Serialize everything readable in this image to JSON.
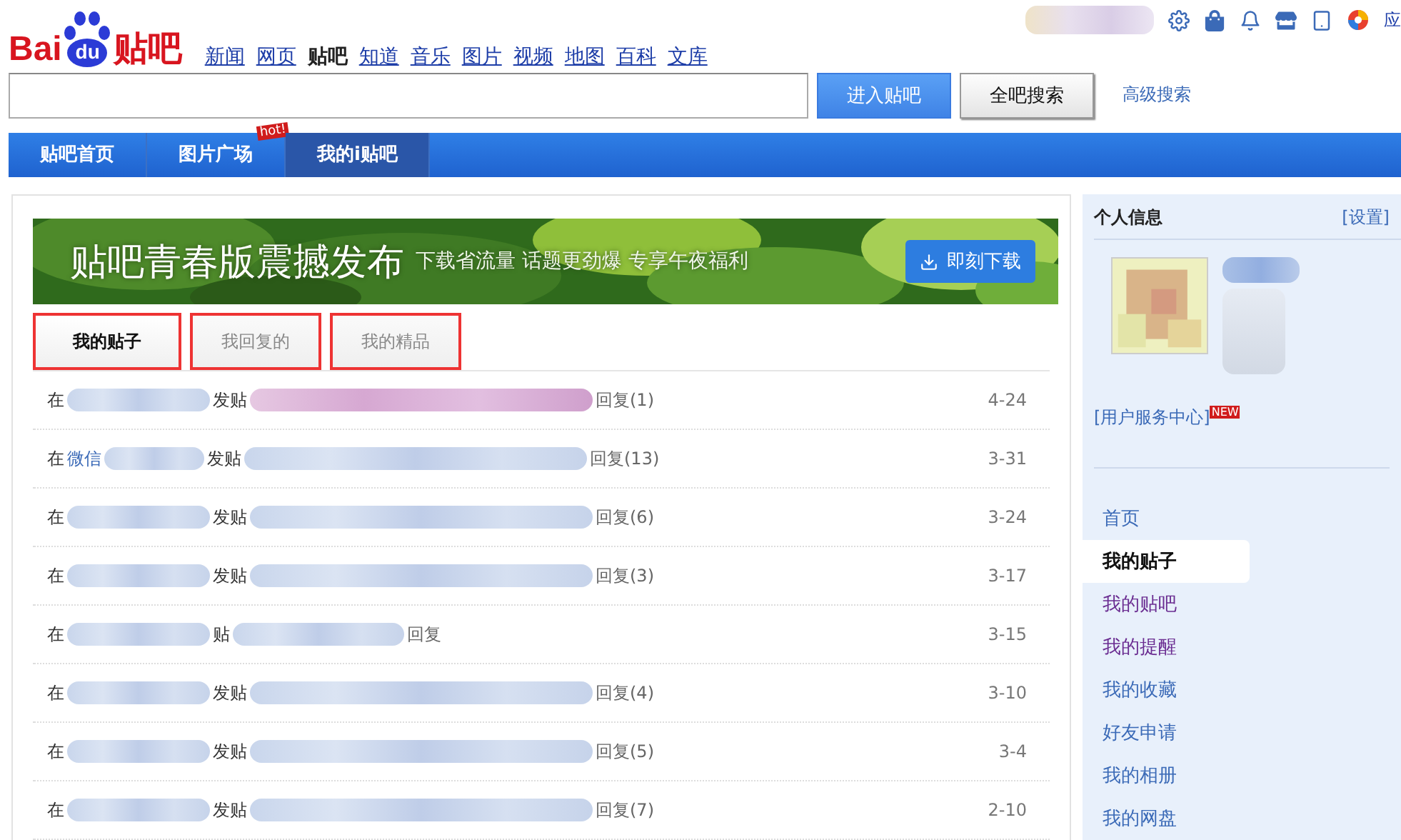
{
  "logo": {
    "left": "Bai",
    "paw": "du",
    "right": "贴吧"
  },
  "top_links": [
    {
      "label": "新闻",
      "selected": false
    },
    {
      "label": "网页",
      "selected": false
    },
    {
      "label": "贴吧",
      "selected": true
    },
    {
      "label": "知道",
      "selected": false
    },
    {
      "label": "音乐",
      "selected": false
    },
    {
      "label": "图片",
      "selected": false
    },
    {
      "label": "视频",
      "selected": false
    },
    {
      "label": "地图",
      "selected": false
    },
    {
      "label": "百科",
      "selected": false
    },
    {
      "label": "文库",
      "selected": false
    }
  ],
  "user_bar": {
    "apps_label": "应"
  },
  "search": {
    "enter_button": "进入贴吧",
    "search_all_button": "全吧搜索",
    "advanced_link": "高级搜索"
  },
  "nav": [
    {
      "label": "贴吧首页",
      "selected": false
    },
    {
      "label": "图片广场",
      "selected": false,
      "badge": "hot!"
    },
    {
      "label": "我的i贴吧",
      "selected": true
    }
  ],
  "banner": {
    "title": "贴吧青春版震撼发布",
    "subtitle": "下载省流量 话题更劲爆 专享午夜福利",
    "button": "即刻下载"
  },
  "tabs": [
    {
      "label": "我的贴子",
      "selected": true,
      "highlighted": true
    },
    {
      "label": "我回复的",
      "selected": false,
      "highlighted": true
    },
    {
      "label": "我的精品",
      "selected": false,
      "highlighted": true
    }
  ],
  "posts": [
    {
      "prefix": "在",
      "action": "发贴",
      "replies": "回复(1)",
      "date": "4-24"
    },
    {
      "prefix": "在",
      "forum": "微信",
      "action": "发贴",
      "replies": "回复(13)",
      "date": "3-31"
    },
    {
      "prefix": "在",
      "action": "发贴",
      "replies": "回复(6)",
      "date": "3-24"
    },
    {
      "prefix": "在",
      "action": "发贴",
      "replies": "回复(3)",
      "date": "3-17"
    },
    {
      "prefix": "在",
      "action": "贴",
      "replies": "回复",
      "date": "3-15"
    },
    {
      "prefix": "在",
      "action": "发贴",
      "replies": "回复(4)",
      "date": "3-10"
    },
    {
      "prefix": "在",
      "action": "发贴",
      "replies": "回复(5)",
      "date": "3-4"
    },
    {
      "prefix": "在",
      "action": "发贴",
      "replies": "回复(7)",
      "date": "2-10"
    }
  ],
  "profile": {
    "title": "个人信息",
    "settings_link": "[设置]",
    "service_link": "[用户服务中心]",
    "service_badge": "NEW"
  },
  "sidebar": {
    "items": [
      {
        "label": "首页",
        "selected": false,
        "visited": false
      },
      {
        "label": "我的贴子",
        "selected": true,
        "visited": false
      },
      {
        "label": "我的贴吧",
        "selected": false,
        "visited": true
      },
      {
        "label": "我的提醒",
        "selected": false,
        "visited": true
      },
      {
        "label": "我的收藏",
        "selected": false,
        "visited": false
      },
      {
        "label": "好友申请",
        "selected": false,
        "visited": false
      },
      {
        "label": "我的相册",
        "selected": false,
        "visited": false
      },
      {
        "label": "我的网盘",
        "selected": false,
        "visited": false
      }
    ]
  }
}
